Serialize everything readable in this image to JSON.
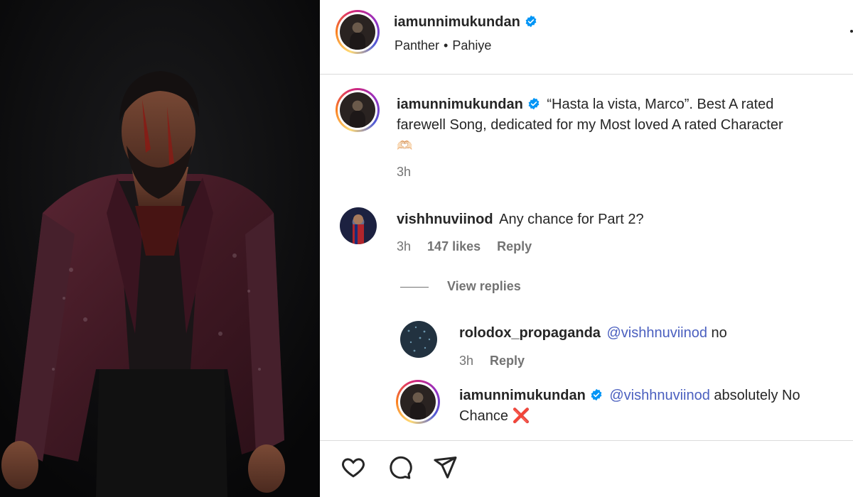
{
  "post": {
    "author": "iamunnimukundan",
    "audio_artist": "Panther",
    "audio_title": "Pahiye",
    "separator": "•"
  },
  "caption": {
    "username": "iamunnimukundan",
    "line1": "“Hasta la vista, Marco”. Best A rated",
    "line2": "farewell Song, dedicated for my Most loved A rated Character",
    "emoji": "🫶🏻",
    "time": "3h"
  },
  "comments": [
    {
      "username": "vishhnuviinod",
      "text": "Any chance for Part 2?",
      "time": "3h",
      "likes": "147 likes",
      "reply_label": "Reply",
      "view_replies": "View replies"
    }
  ],
  "replies": [
    {
      "username": "rolodox_propaganda",
      "mention": "@vishhnuviinod",
      "text": "no",
      "time": "3h",
      "reply_label": "Reply"
    },
    {
      "username": "iamunnimukundan",
      "mention": "@vishhnuviinod",
      "text_a": "absolutely No",
      "text_b": "Chance",
      "emoji": "❌"
    }
  ],
  "icons": {
    "like": "heart-icon",
    "comment": "comment-icon",
    "share": "share-icon",
    "verified": "verified-badge-icon",
    "more": "more-options-icon"
  },
  "colors": {
    "verified": "#0095f6",
    "mention": "#4a5fbf",
    "muted": "#737373",
    "jacket": "#4a1f2b"
  }
}
